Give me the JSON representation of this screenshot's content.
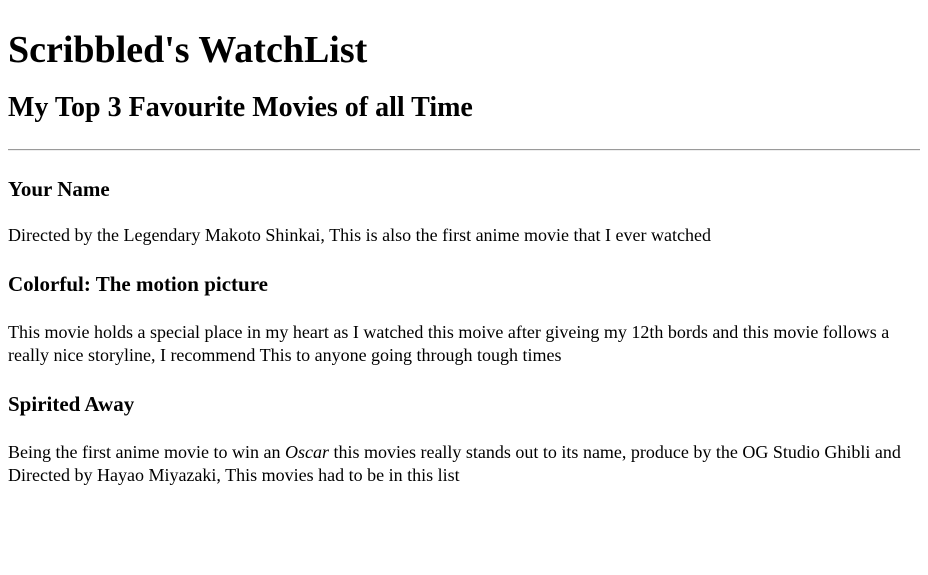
{
  "site_title": "Scribbled's WatchList",
  "section_title": "My Top 3 Favourite Movies of all Time",
  "movies": [
    {
      "title": "Your Name",
      "description": "Directed by the Legendary Makoto Shinkai, This is also the first anime movie that I ever watched"
    },
    {
      "title": "Colorful: The motion picture",
      "description": "This movie holds a special place in my heart as I watched this moive after giveing my 12th bords and this movie follows a really nice storyline, I recommend This to anyone going through tough times"
    },
    {
      "title": "Spirited Away",
      "description_before": "Being the first anime movie to win an ",
      "description_emphasis": "Oscar",
      "description_after": " this movies really stands out to its name, produce by the OG Studio Ghibli and Directed by Hayao Miyazaki, This movies had to be in this list"
    }
  ]
}
